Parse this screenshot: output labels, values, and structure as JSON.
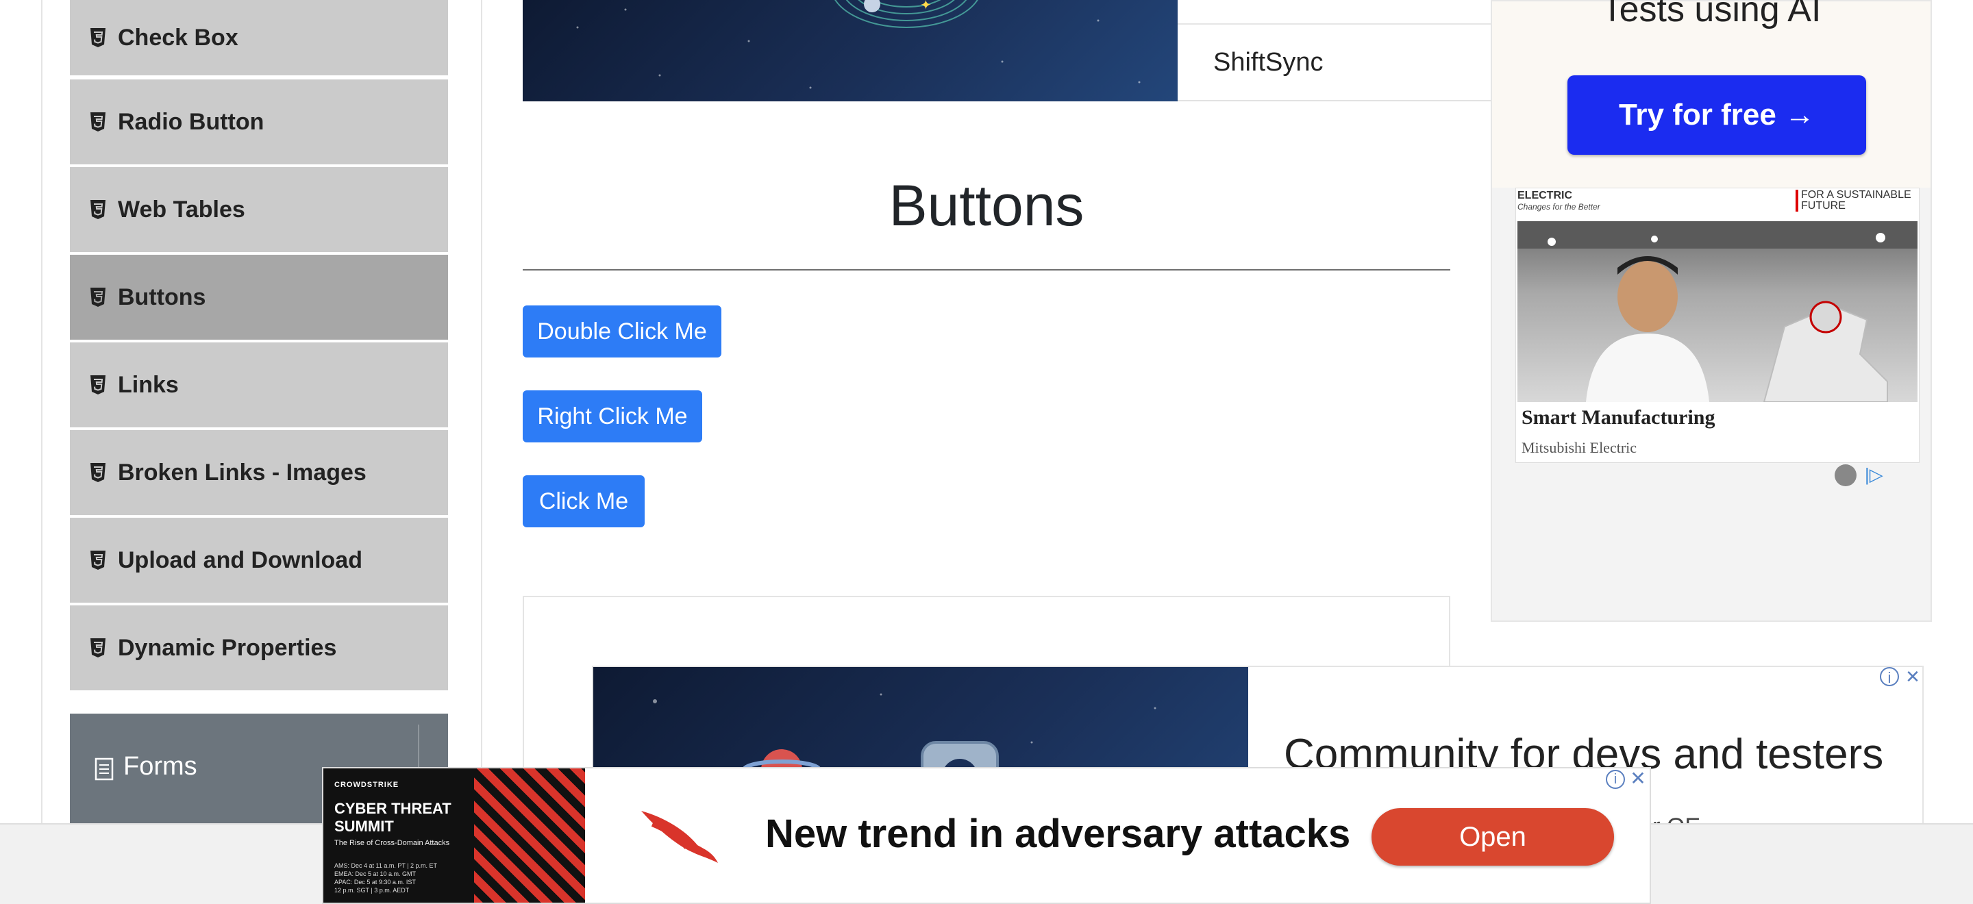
{
  "sidebar": {
    "items": [
      {
        "label": "Check Box",
        "active": false
      },
      {
        "label": "Radio Button",
        "active": false
      },
      {
        "label": "Web Tables",
        "active": false
      },
      {
        "label": "Buttons",
        "active": true
      },
      {
        "label": "Links",
        "active": false
      },
      {
        "label": "Broken Links - Images",
        "active": false
      },
      {
        "label": "Upload and Download",
        "active": false
      },
      {
        "label": "Dynamic Properties",
        "active": false
      }
    ],
    "item_icon": "html5-icon",
    "forms_group": {
      "label": "Forms",
      "icon": "document-icon",
      "toggle_icon": "plus-icon"
    }
  },
  "top_banner": {
    "text": "ShiftSync"
  },
  "main": {
    "title": "Buttons",
    "buttons": {
      "double_click": "Double Click Me",
      "right_click": "Right Click Me",
      "click": "Click Me"
    },
    "button_color": "#2d7cf6"
  },
  "right_ad": {
    "heading": "Tests using AI",
    "cta": "Try for free →",
    "brand_left": "ELECTRIC",
    "brand_tagline": "Changes for the Better",
    "brand_right": "FOR A SUSTAINABLE FUTURE",
    "card_title": "Smart Manufacturing",
    "card_subtitle": "Mitsubishi Electric"
  },
  "middle_ad": {
    "headline": "Community for devs and testers",
    "subline": "other QE"
  },
  "bottom_ad": {
    "brand": "CROWDSTRIKE",
    "event_title": "CYBER THREAT SUMMIT",
    "event_sub": "The Rise of Cross-Domain Attacks",
    "dates": [
      "AMS: Dec 4 at 11 a.m. PT | 2 p.m. ET",
      "EMEA: Dec 5 at 10 a.m. GMT",
      "APAC: Dec 5 at 9:30 a.m. IST",
      "12 p.m. SGT | 3 p.m. AEDT"
    ],
    "headline": "New trend in adversary attacks",
    "cta": "Open",
    "cta_color": "#d9472f"
  }
}
